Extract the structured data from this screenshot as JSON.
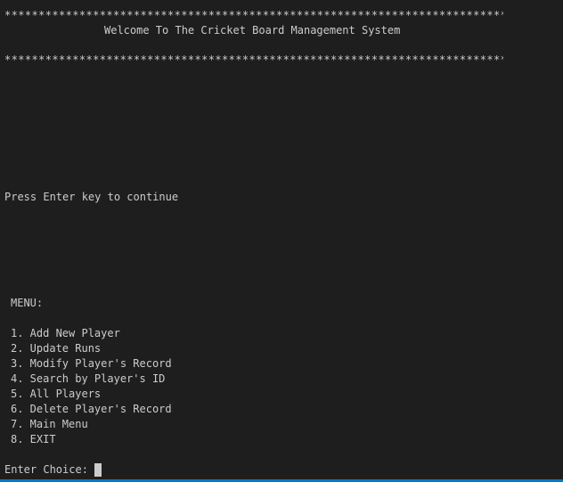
{
  "banner": {
    "stars_top": "**********************************************************************************",
    "title": "Welcome To The Cricket Board Management System",
    "stars_bottom": "**********************************************************************************"
  },
  "press_enter": "Press Enter key to continue",
  "menu": {
    "title": "MENU:",
    "items": [
      "1. Add New Player",
      "2. Update Runs",
      "3. Modify Player's Record",
      "4. Search by Player's ID",
      "5. All Players",
      "6. Delete Player's Record",
      "7. Main Menu",
      "8. EXIT"
    ]
  },
  "prompt": "Enter Choice:",
  "colors": {
    "background": "#1e1e1e",
    "text": "#cccccc",
    "status_bar": "#007acc"
  }
}
